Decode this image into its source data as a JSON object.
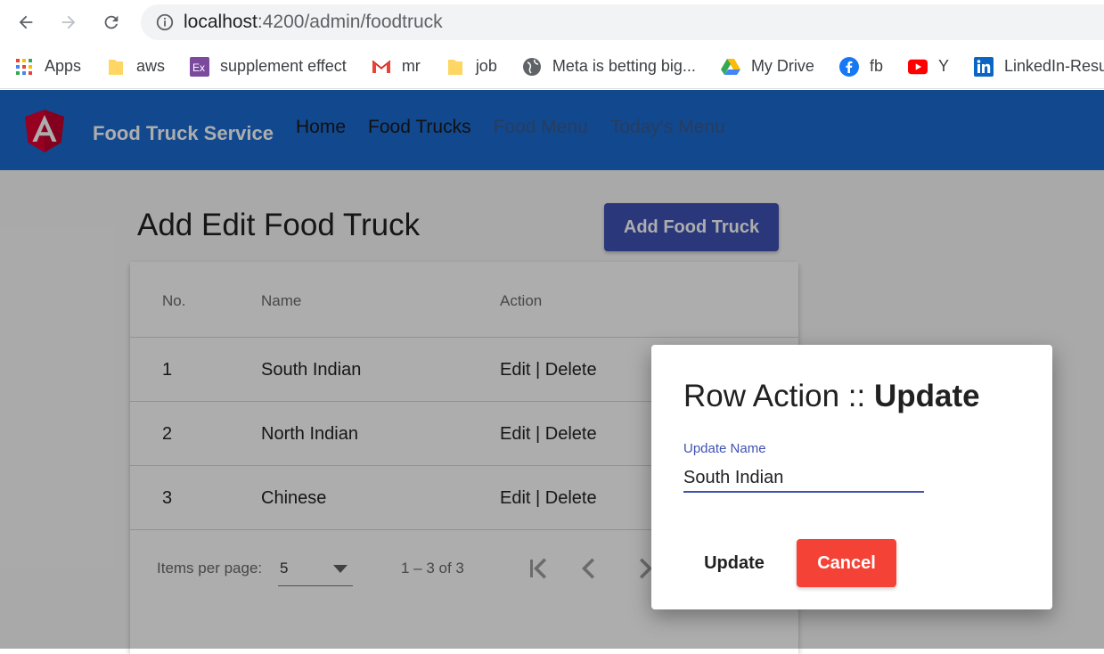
{
  "browser": {
    "url_host": "localhost",
    "url_path": ":4200/admin/foodtruck",
    "bookmarks": [
      {
        "label": "Apps",
        "icon": "apps-grid-icon"
      },
      {
        "label": "aws",
        "icon": "folder-icon"
      },
      {
        "label": "supplement effect",
        "icon": "ex-icon"
      },
      {
        "label": "mr",
        "icon": "gmail-icon"
      },
      {
        "label": "job",
        "icon": "folder-icon"
      },
      {
        "label": "Meta is betting big...",
        "icon": "globe-icon"
      },
      {
        "label": "My Drive",
        "icon": "google-drive-icon"
      },
      {
        "label": "fb",
        "icon": "facebook-icon"
      },
      {
        "label": "Y",
        "icon": "youtube-icon"
      },
      {
        "label": "LinkedIn-Resum",
        "icon": "linkedin-icon"
      }
    ]
  },
  "app": {
    "brand": "Food Truck Service",
    "nav": [
      {
        "label": "Home",
        "color": "#1a1a1a"
      },
      {
        "label": "Food Trucks",
        "color": "#1a1a1a"
      },
      {
        "label": "Food Menu",
        "color": "#3a5a8c"
      },
      {
        "label": "Today's Menu",
        "color": "#3a5a8c"
      }
    ]
  },
  "page": {
    "title": "Add Edit Food Truck",
    "add_button": "Add Food Truck"
  },
  "table": {
    "headers": [
      "No.",
      "Name",
      "Action"
    ],
    "rows": [
      {
        "no": "1",
        "name": "South Indian",
        "action": "Edit | Delete"
      },
      {
        "no": "2",
        "name": "North Indian",
        "action": "Edit | Delete"
      },
      {
        "no": "3",
        "name": "Chinese",
        "action": "Edit | Delete"
      }
    ]
  },
  "paginator": {
    "items_label": "Items per page:",
    "page_size": "5",
    "range": "1 – 3 of 3"
  },
  "dialog": {
    "title_prefix": "Row Action :: ",
    "title_action": "Update",
    "field_label": "Update Name",
    "field_value": "South Indian",
    "update_button": "Update",
    "cancel_button": "Cancel"
  },
  "colors": {
    "toolbar": "#1b6ad0",
    "primary": "#3f51b5",
    "warn": "#f44336"
  }
}
